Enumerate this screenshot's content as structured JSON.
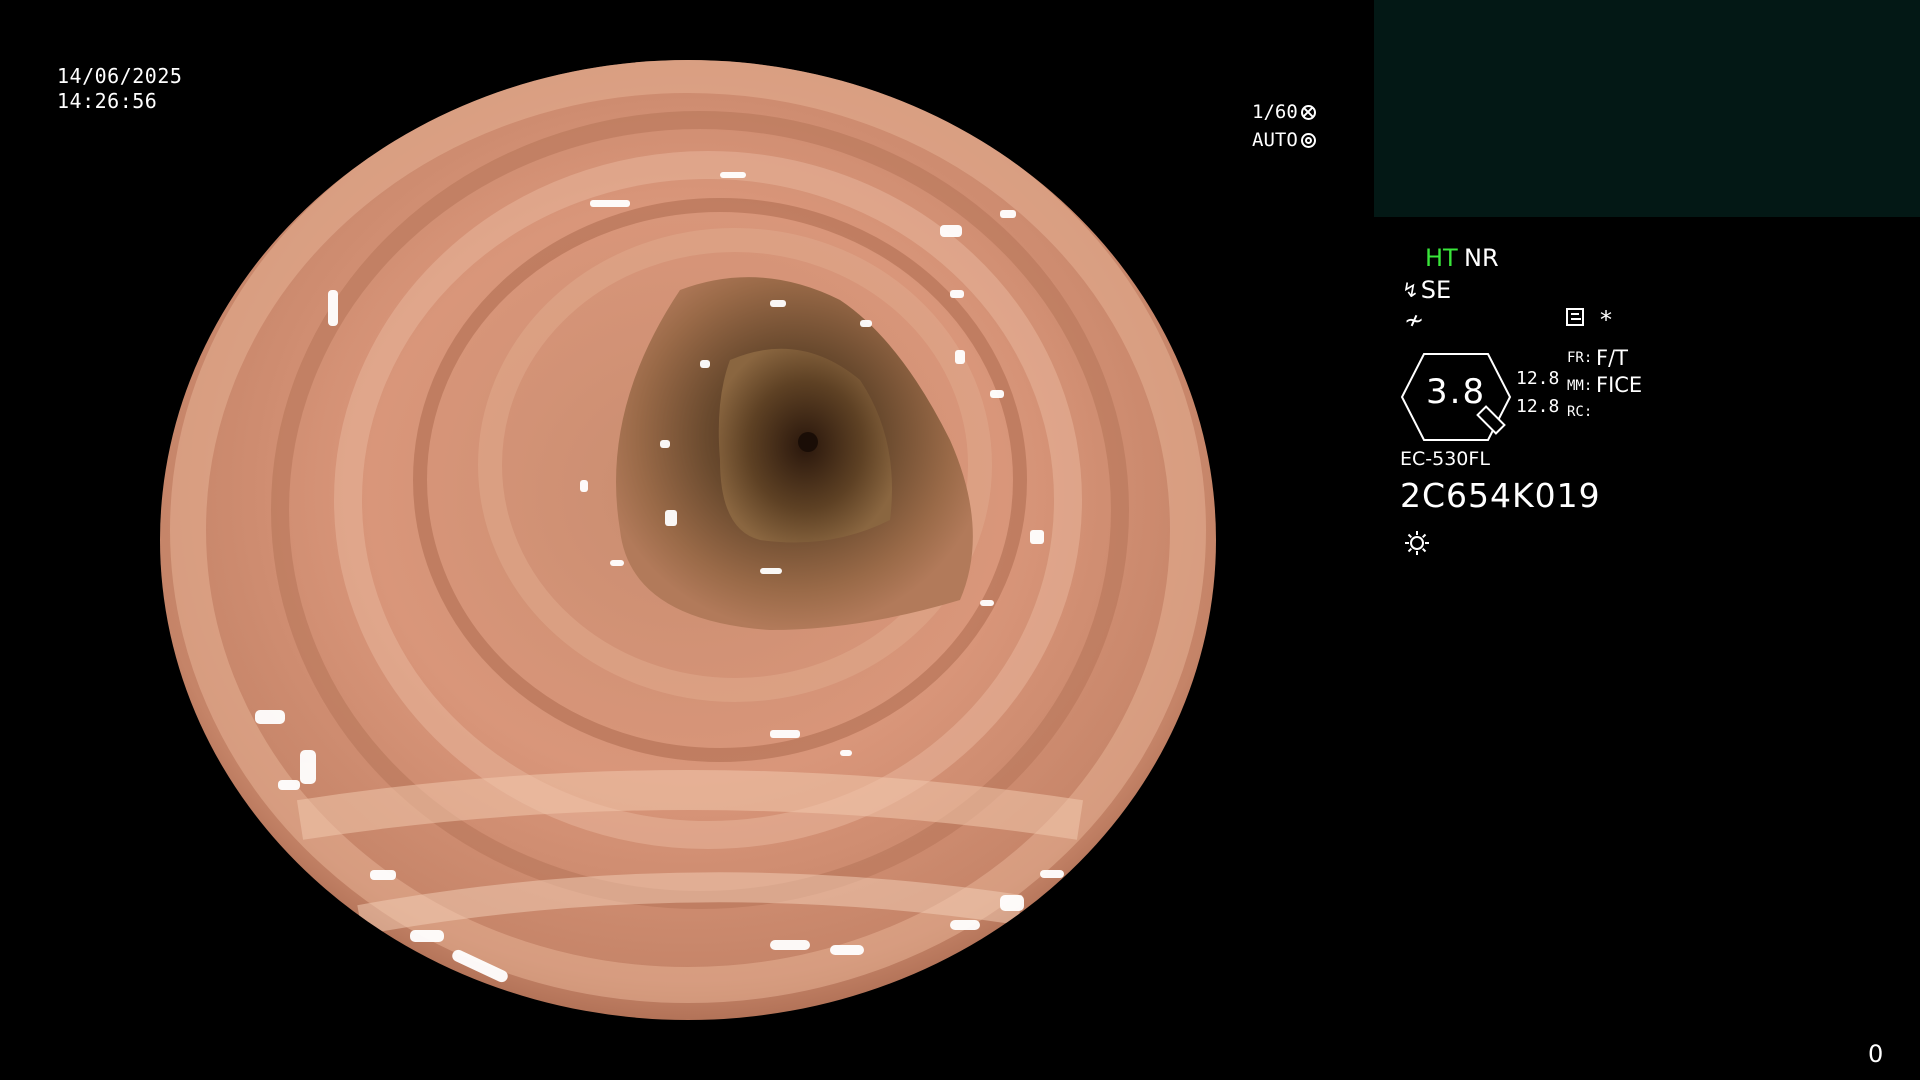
{
  "overlay": {
    "date": "14/06/2025",
    "time": "14:26:56",
    "shutter": "1/60",
    "iris_mode": "AUTO",
    "corner_counter": "0"
  },
  "panel": {
    "ht": "HT",
    "nr": "NR",
    "se": "SE",
    "zoom": "3.8",
    "value_top": "12.8",
    "value_bottom": "12.8",
    "fr_label": "FR:",
    "fr_value": "F/T",
    "mm_label": "MM:",
    "mm_value": "FICE",
    "rc_label": "RC:",
    "scope_model": "EC-530FL",
    "scope_serial": "2C654K019"
  },
  "colors": {
    "ht_accent": "#39e63a",
    "thumbnail_bg": "#031815"
  },
  "icons": {
    "shutter": "wheel-icon",
    "iris": "ring-icon",
    "se": "scope-icon",
    "structure": "slash-f-icon",
    "document": "document-icon",
    "star": "asterisk-icon",
    "light": "sun-icon"
  }
}
